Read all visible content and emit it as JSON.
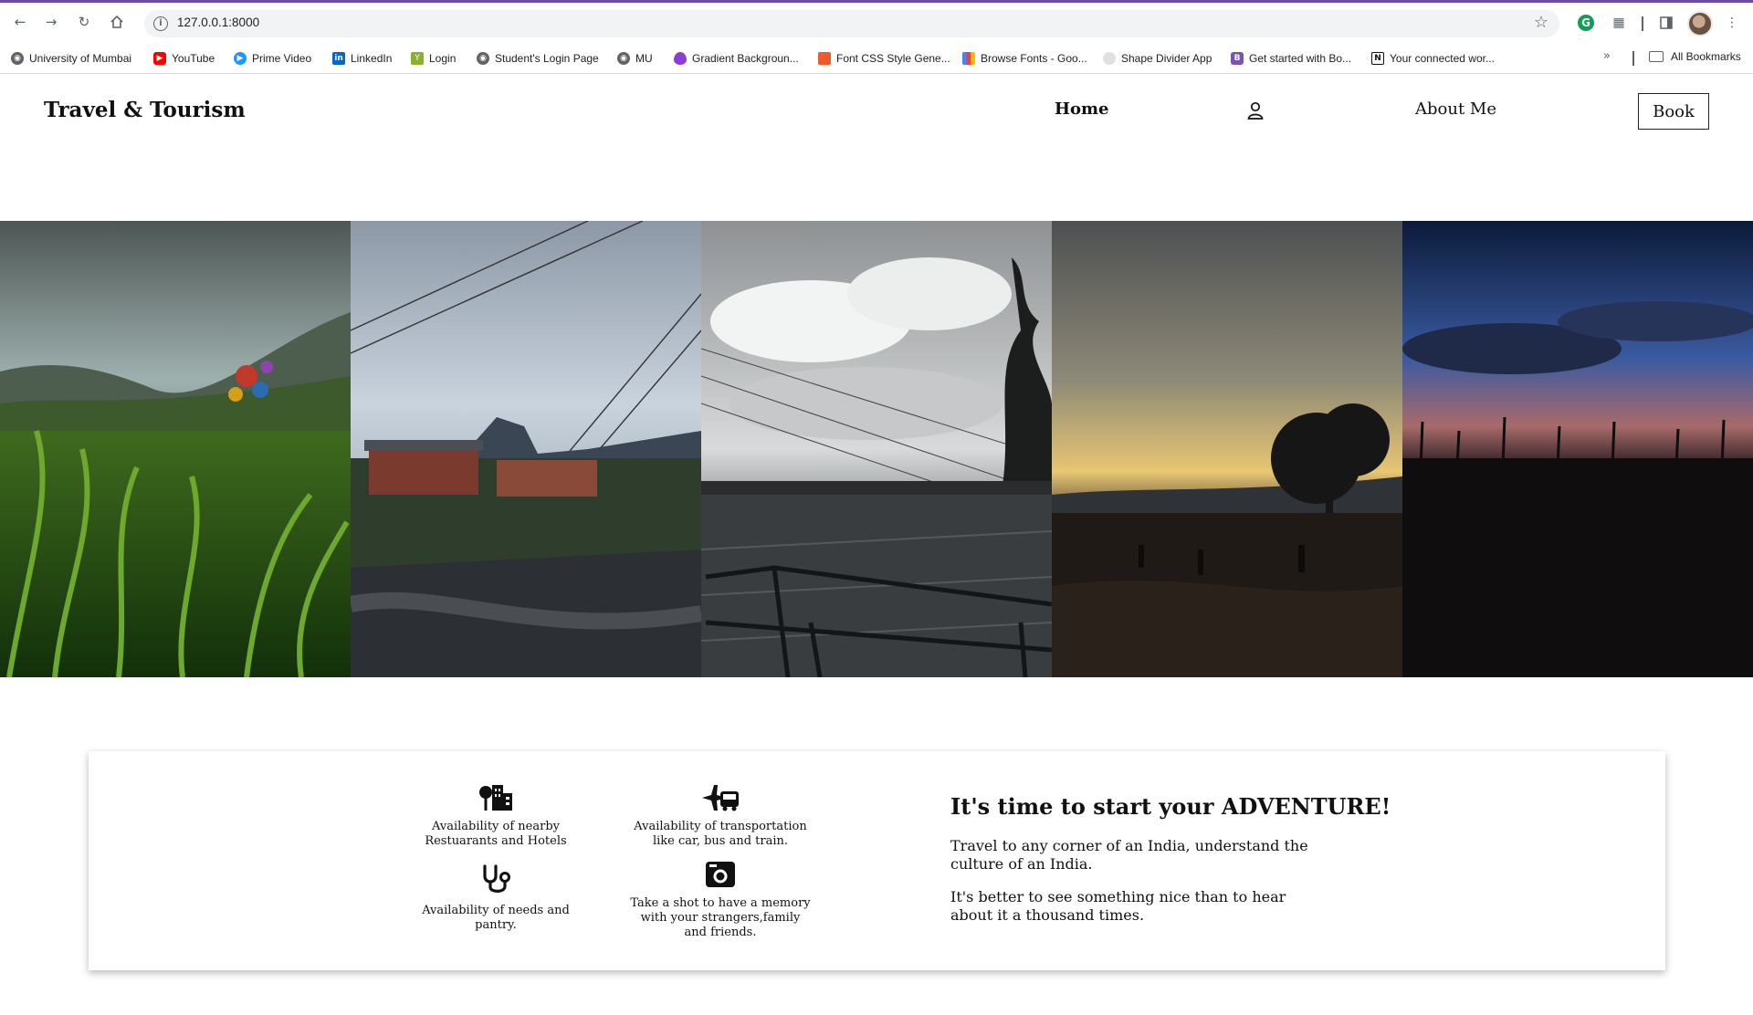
{
  "browser": {
    "url": "127.0.0.1:8000",
    "bookmarks": [
      {
        "label": "University of Mumbai",
        "icon": "globe-icon",
        "color": "#5f6368"
      },
      {
        "label": "YouTube",
        "icon": "youtube-icon",
        "color": "#ff0000"
      },
      {
        "label": "Prime Video",
        "icon": "prime-video-icon",
        "color": "#1a98ff"
      },
      {
        "label": "LinkedIn",
        "icon": "linkedin-icon",
        "color": "#0a66c2"
      },
      {
        "label": "Login",
        "icon": "login-icon",
        "color": "#8ab02e"
      },
      {
        "label": "Student's Login Page",
        "icon": "globe-icon",
        "color": "#5f6368"
      },
      {
        "label": "MU",
        "icon": "globe-icon",
        "color": "#5f6368"
      },
      {
        "label": "Gradient Backgroun...",
        "icon": "gradient-icon",
        "color": "#8b3dd6"
      },
      {
        "label": "Font CSS Style Gene...",
        "icon": "font-css-icon",
        "color": "#f0592b"
      },
      {
        "label": "Browse Fonts - Goo...",
        "icon": "google-fonts-icon",
        "color": "#4285f4"
      },
      {
        "label": "Shape Divider App",
        "icon": "shape-divider-icon",
        "color": "#cccccc"
      },
      {
        "label": "Get started with Bo...",
        "icon": "bootstrap-icon",
        "color": "#7952b3"
      },
      {
        "label": "Your connected wor...",
        "icon": "notion-icon",
        "color": "#111111"
      }
    ],
    "all_bookmarks": "All Bookmarks"
  },
  "site": {
    "brand": "Travel & Tourism",
    "nav": {
      "home": "Home",
      "about": "About Me",
      "book": "Book"
    }
  },
  "features": [
    {
      "icon": "restaurant-hotel-icon",
      "text": "Availability of nearby Restuarants and Hotels"
    },
    {
      "icon": "transport-icon",
      "text": "Availability of transportation like car, bus and train."
    },
    {
      "icon": "stethoscope-icon",
      "text": "Availability of needs and pantry."
    },
    {
      "icon": "camera-icon",
      "text": "Take a shot to have a memory with your strangers,family and friends."
    }
  ],
  "adventure": {
    "title": "It's time to start your ADVENTURE!",
    "p1": "Travel to any corner of an India, understand the culture of an India.",
    "p2": "It's better to see something nice than to hear about it a thousand times."
  }
}
